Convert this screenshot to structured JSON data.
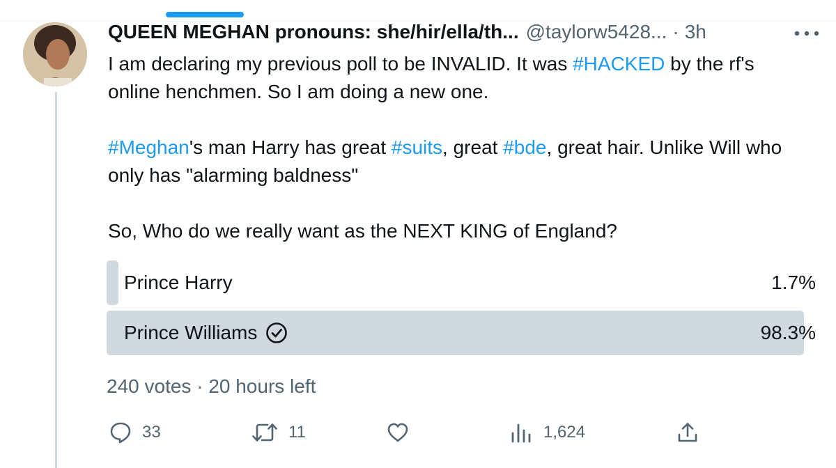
{
  "tweet": {
    "display_name": "QUEEN MEGHAN pronouns: she/hir/ella/th...",
    "handle": "@taylorw5428...",
    "separator": "·",
    "time": "3h",
    "paragraph1": {
      "before": "I am declaring my previous poll to be INVALID. It was ",
      "hashtag": "#HACKED",
      "after": " by the rf's online henchmen. So I am doing a new one."
    },
    "paragraph2": {
      "hashtag1": "#Meghan",
      "text1": "'s man Harry has great ",
      "hashtag2": "#suits",
      "text2": ", great ",
      "hashtag3": "#bde",
      "text3": ", great hair. Unlike Will who only has \"alarming baldness\""
    },
    "paragraph3": "So, Who do we really want as the NEXT KING of England?"
  },
  "poll": {
    "options": [
      {
        "label": "Prince Harry",
        "percent_text": "1.7%",
        "percent": 1.7,
        "selected": false
      },
      {
        "label": "Prince Williams",
        "percent_text": "98.3%",
        "percent": 98.3,
        "selected": true
      }
    ],
    "votes": "240 votes",
    "separator": "·",
    "time_left": "20 hours left"
  },
  "actions": {
    "replies": "33",
    "retweets": "11",
    "views": "1,624"
  },
  "colors": {
    "accent": "#1d9bf0",
    "secondary_text": "#536471",
    "poll_fill": "#cfd9de"
  },
  "icons": [
    "more-icon",
    "check-circle-icon",
    "reply-icon",
    "retweet-icon",
    "like-icon",
    "views-icon",
    "share-icon"
  ]
}
